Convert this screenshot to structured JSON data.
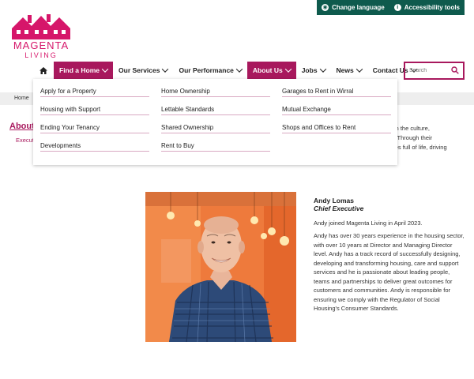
{
  "utility": {
    "change_language": "Change language",
    "accessibility_tools": "Accessibility tools"
  },
  "logo": {
    "line1": "MAGENTA",
    "line2": "LIVING"
  },
  "colors": {
    "brand_magenta": "#d6166a",
    "nav_active": "#a8185d",
    "utility_bar": "#0e5a4d"
  },
  "nav": {
    "items": [
      {
        "label": "Find a Home",
        "active": true
      },
      {
        "label": "Our Services",
        "active": false
      },
      {
        "label": "Our Performance",
        "active": false
      },
      {
        "label": "About Us",
        "active": true
      },
      {
        "label": "Jobs",
        "active": false
      },
      {
        "label": "News",
        "active": false
      },
      {
        "label": "Contact Us",
        "active": false
      }
    ],
    "search_placeholder": "Search"
  },
  "breadcrumb": {
    "home": "Home"
  },
  "background_page": {
    "title_fragment": "About",
    "subtitle_fragment": "Execut",
    "text_fragments": [
      "sform the culture,",
      "ond. Through their",
      "unities full of life, driving"
    ]
  },
  "dropdown": {
    "columns": [
      [
        "Apply for a Property",
        "Housing with Support",
        "Ending Your Tenancy",
        "Developments"
      ],
      [
        "Home Ownership",
        "Lettable Standards",
        "Shared Ownership",
        "Rent to Buy"
      ],
      [
        "Garages to Rent in Wirral",
        "Mutual Exchange",
        "Shops and Offices to Rent"
      ]
    ]
  },
  "profile": {
    "name": "Andy Lomas",
    "role": "Chief Executive",
    "intro": "Andy joined Magenta Living in April 2023.",
    "bio": "Andy has over 30 years experience in the housing sector, with over 10 years at Director and Managing Director level. Andy has a track record of successfully designing, developing and transforming housing, care and support services and he is passionate about leading people, teams and partnerships to deliver great outcomes for customers and communities. Andy is responsible for ensuring we comply with the Regulator of Social Housing's Consumer Standards."
  }
}
